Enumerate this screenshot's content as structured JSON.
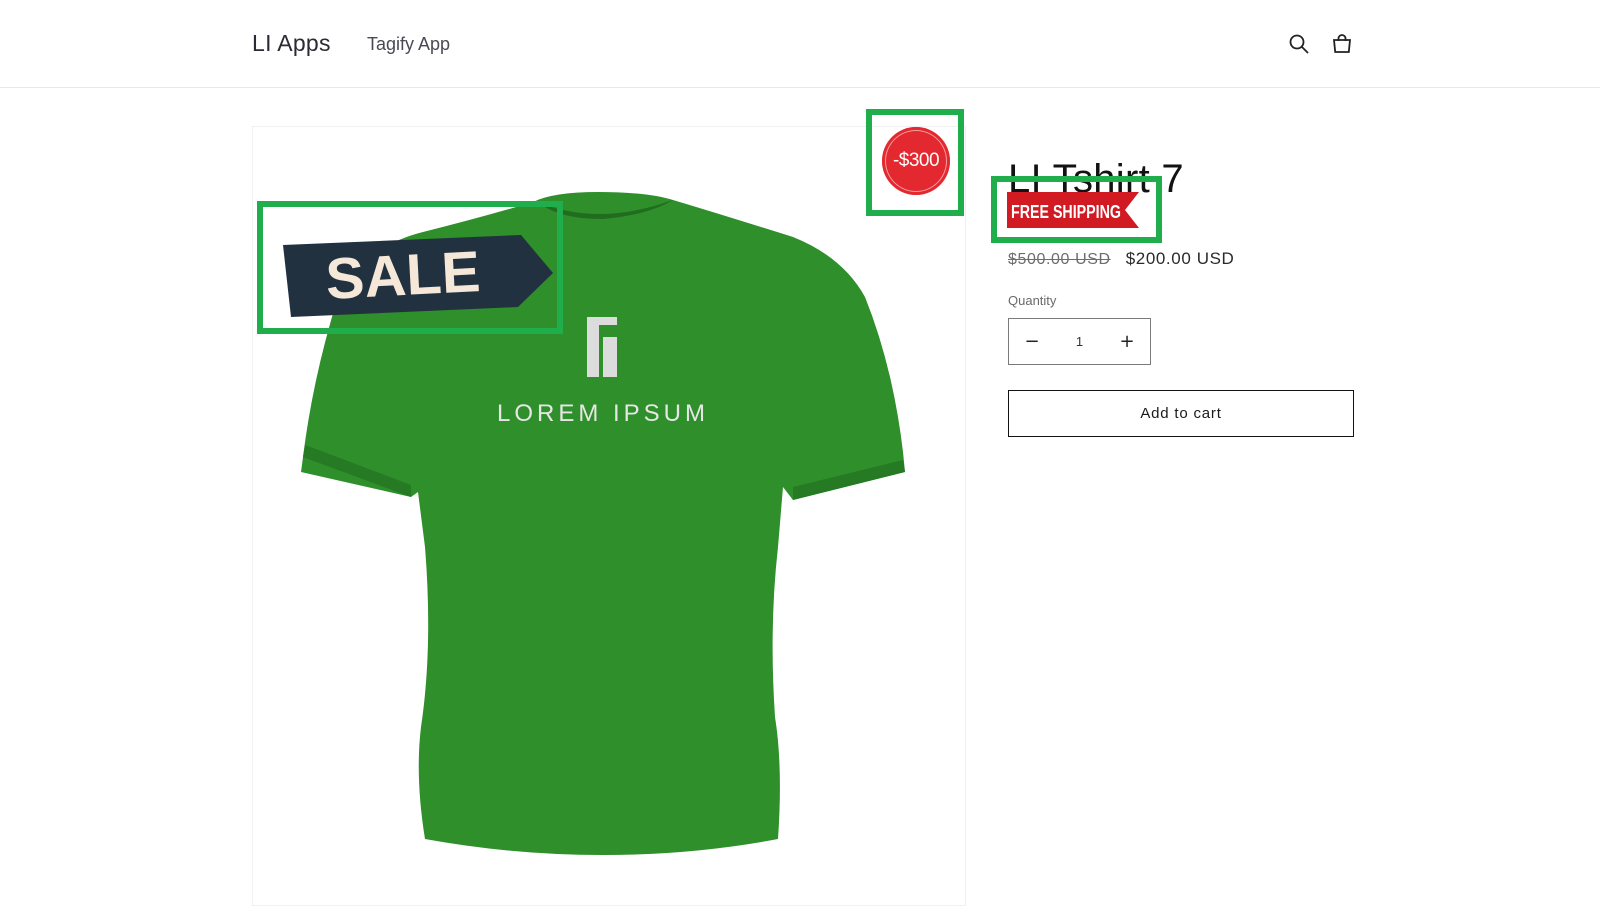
{
  "header": {
    "brand": "LI Apps",
    "nav_link": "Tagify App",
    "search_icon": "search-icon",
    "cart_icon": "cart-icon"
  },
  "product": {
    "title": "LI Tshirt 7",
    "price_old": "$500.00 USD",
    "price_new": "$200.00 USD",
    "quantity_label": "Quantity",
    "quantity_value": "1",
    "add_to_cart_label": "Add to cart"
  },
  "badges": {
    "sale": "SALE",
    "discount": "-$300",
    "free_shipping": "FREE SHIPPING",
    "tshirt_print": "LOREM IPSUM"
  },
  "colors": {
    "shirt": "#2e8f2b",
    "highlight_frame": "#1fae4b",
    "discount_badge": "#e4282f",
    "ribbon": "#d11a22",
    "sale_tag": "#223140"
  }
}
